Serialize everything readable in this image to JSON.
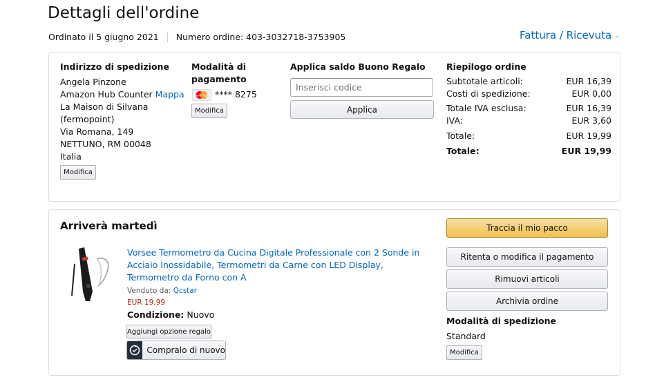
{
  "header": {
    "title": "Dettagli dell'ordine",
    "ordered_on": "Ordinato il 5 giugno 2021",
    "order_number": "Numero ordine: 403-3032718-3753905",
    "invoice_link": "Fattura / Ricevuta"
  },
  "shipping_address": {
    "heading": "Indirizzo di spedizione",
    "name": "Angela Pinzone",
    "line1": "Amazon Hub Counter",
    "map_link": "Mappa",
    "line2": "La Maison di Silvana",
    "line3": "(fermopoint)",
    "line4": "Via Romana, 149",
    "line5": "NETTUNO, RM 00048",
    "line6": "Italia",
    "edit_button": "Modifica"
  },
  "payment": {
    "heading_line1": "Modalità di",
    "heading_line2": "pagamento",
    "card_icon": "mastercard-icon",
    "card_brand_text": "MasterCard",
    "card_digits": "**** 8275",
    "edit_button": "Modifica"
  },
  "gift_card": {
    "heading": "Applica saldo Buono Regalo",
    "input_placeholder": "Inserisci codice",
    "apply_button": "Applica"
  },
  "summary": {
    "heading": "Riepilogo ordine",
    "rows": [
      {
        "label": "Subtotale articoli:",
        "value": "EUR 16,39"
      },
      {
        "label": "Costi di spedizione:",
        "value": "EUR 0,00"
      },
      {
        "label": "Totale IVA esclusa:",
        "value": "EUR 16,39"
      },
      {
        "label": "IVA:",
        "value": "EUR 3,60"
      },
      {
        "label": "Totale:",
        "value": "EUR 19,99"
      },
      {
        "label": "Totale:",
        "value": "EUR 19,99"
      }
    ]
  },
  "shipment": {
    "arrival": "Arriverà martedì",
    "product_title": "Vorsee Termometro da Cucina Digitale Professionale con 2 Sonde in Acciaio Inossidabile, Termometri da Carne con LED Display, Termometro da Forno con A",
    "sold_by_label": "Venduto da:",
    "seller": "Qcstar",
    "price": "EUR 19,99",
    "condition_label": "Condizione:",
    "condition_value": "Nuovo",
    "gift_option_button": "Aggiungi opzione regalo",
    "buy_again_button": "Compralo di nuovo",
    "track_button": "Traccia il mio pacco",
    "retry_payment_button": "Ritenta o modifica il pagamento",
    "remove_items_button": "Rimuovi articoli",
    "archive_button": "Archivia ordine",
    "shipping_method_heading": "Modalità di spedizione",
    "shipping_method_value": "Standard",
    "shipping_edit_button": "Modifica"
  },
  "colors": {
    "link": "#0066c0",
    "price": "#b12704",
    "primary_button": "#f0c14b",
    "border": "#dddddd"
  }
}
